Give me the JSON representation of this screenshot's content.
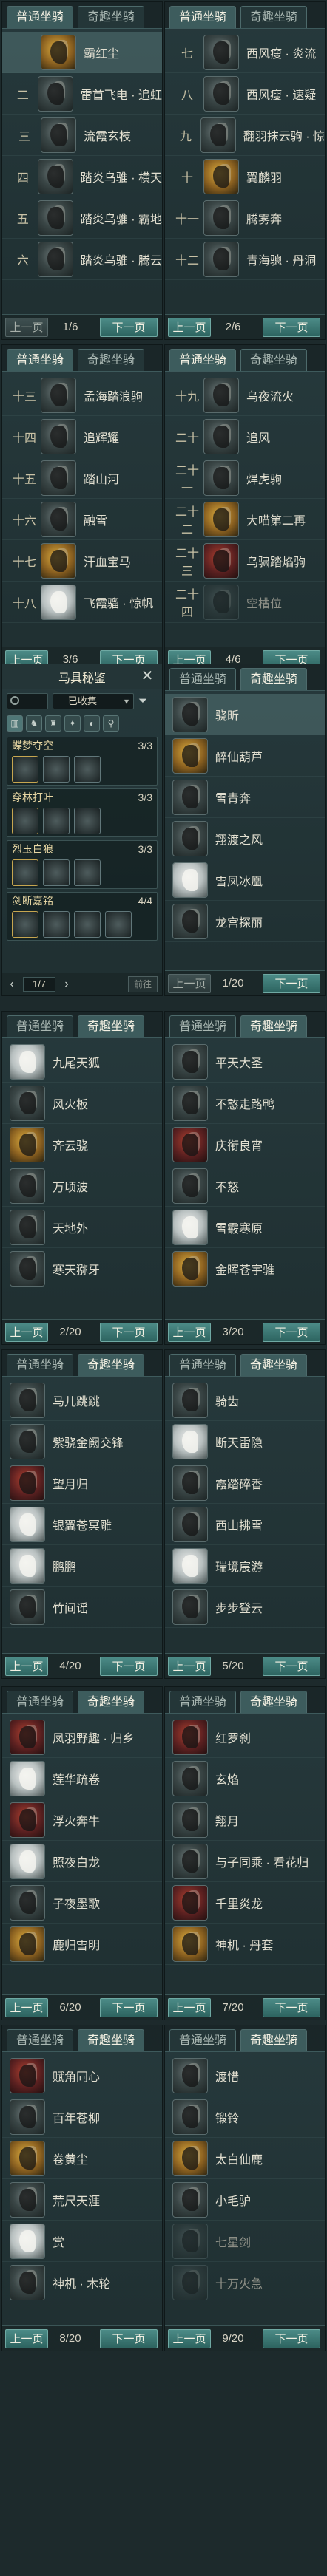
{
  "tabs": {
    "common": "普通坐骑",
    "special": "奇趣坐骑"
  },
  "buttons": {
    "prev": "上一页",
    "next": "下一页"
  },
  "panels": [
    {
      "page": "1/6",
      "prev_enabled": false,
      "rows": [
        {
          "idx": "",
          "name": "霸红尘",
          "icon": "horse-head-icon",
          "tone": "gold",
          "selected": true
        },
        {
          "idx": "二",
          "name": "雷首飞电 · 追虹",
          "icon": "horse-head-icon",
          "tone": ""
        },
        {
          "idx": "三",
          "name": "流霞玄枝",
          "icon": "horse-head-icon",
          "tone": ""
        },
        {
          "idx": "四",
          "name": "踏炎乌骓 · 横天",
          "icon": "horse-head-icon",
          "tone": ""
        },
        {
          "idx": "五",
          "name": "踏炎乌骓 · 霸地",
          "icon": "horse-head-icon",
          "tone": ""
        },
        {
          "idx": "六",
          "name": "踏炎乌骓 · 腾云",
          "icon": "horse-head-icon",
          "tone": ""
        }
      ]
    },
    {
      "page": "2/6",
      "prev_enabled": true,
      "rows": [
        {
          "idx": "七",
          "name": "西风瘦 · 炎流",
          "icon": "horse-head-icon",
          "tone": ""
        },
        {
          "idx": "八",
          "name": "西风瘦 · 速疑",
          "icon": "horse-head-icon",
          "tone": ""
        },
        {
          "idx": "九",
          "name": "翻羽抹云驹 · 惊",
          "icon": "horse-head-icon",
          "tone": ""
        },
        {
          "idx": "十",
          "name": "翼麟羽",
          "icon": "horse-head-icon",
          "tone": "gold"
        },
        {
          "idx": "十一",
          "name": "腾雾奔",
          "icon": "horse-head-icon",
          "tone": ""
        },
        {
          "idx": "十二",
          "name": "青海骢 · 丹洞",
          "icon": "horse-head-icon",
          "tone": ""
        }
      ]
    },
    {
      "page": "3/6",
      "prev_enabled": true,
      "rows": [
        {
          "idx": "十三",
          "name": "孟海踏浪驹",
          "icon": "horse-head-icon",
          "tone": ""
        },
        {
          "idx": "十四",
          "name": "追辉耀",
          "icon": "horse-head-icon",
          "tone": ""
        },
        {
          "idx": "十五",
          "name": "踏山河",
          "icon": "horse-head-icon",
          "tone": ""
        },
        {
          "idx": "十六",
          "name": "融雪",
          "icon": "horse-head-icon",
          "tone": ""
        },
        {
          "idx": "十七",
          "name": "汗血宝马",
          "icon": "horse-head-icon",
          "tone": "gold"
        },
        {
          "idx": "十八",
          "name": "飞霞骝 · 惊帆",
          "icon": "horse-head-icon",
          "tone": "light"
        }
      ]
    },
    {
      "page": "4/6",
      "prev_enabled": true,
      "rows": [
        {
          "idx": "十九",
          "name": "乌夜流火",
          "icon": "horse-head-icon",
          "tone": ""
        },
        {
          "idx": "二十",
          "name": "追风",
          "icon": "horse-head-icon",
          "tone": ""
        },
        {
          "idx": "二十一",
          "name": "焊虎驹",
          "icon": "horse-head-icon",
          "tone": ""
        },
        {
          "idx": "二十二",
          "name": "大喵第二再",
          "icon": "cat-face-icon",
          "tone": "gold"
        },
        {
          "idx": "二十三",
          "name": "乌骕踏焰驹",
          "icon": "horse-head-icon",
          "tone": "red"
        },
        {
          "idx": "二十四",
          "name": "空槽位",
          "icon": "empty-slot-icon",
          "tone": "dim",
          "dim": true
        }
      ]
    },
    {
      "page": "1/20",
      "prev_enabled": false,
      "special": true,
      "rows": [
        {
          "idx": "",
          "name": "骁昕",
          "icon": "mount-icon",
          "tone": "",
          "selected": true
        },
        {
          "idx": "",
          "name": "醉仙葫芦",
          "icon": "gourd-icon",
          "tone": "gold"
        },
        {
          "idx": "",
          "name": "雪青奔",
          "icon": "mount-icon",
          "tone": ""
        },
        {
          "idx": "",
          "name": "翔渡之风",
          "icon": "mount-icon",
          "tone": ""
        },
        {
          "idx": "",
          "name": "雪凤冰凰",
          "icon": "phoenix-icon",
          "tone": "light"
        },
        {
          "idx": "",
          "name": "龙宫探丽",
          "icon": "mount-icon",
          "tone": ""
        }
      ]
    },
    {
      "page": "2/20",
      "prev_enabled": true,
      "special": true,
      "rows": [
        {
          "idx": "",
          "name": "九尾天狐",
          "icon": "fox-icon",
          "tone": "light"
        },
        {
          "idx": "",
          "name": "风火板",
          "icon": "board-icon",
          "tone": ""
        },
        {
          "idx": "",
          "name": "齐云骁",
          "icon": "mount-icon",
          "tone": "gold"
        },
        {
          "idx": "",
          "name": "万顷波",
          "icon": "mount-icon",
          "tone": ""
        },
        {
          "idx": "",
          "name": "天地外",
          "icon": "mount-icon",
          "tone": ""
        },
        {
          "idx": "",
          "name": "寒天猕牙",
          "icon": "mount-icon",
          "tone": ""
        }
      ]
    },
    {
      "page": "3/20",
      "prev_enabled": true,
      "special": true,
      "rows": [
        {
          "idx": "",
          "name": "平天大圣",
          "icon": "mount-icon",
          "tone": ""
        },
        {
          "idx": "",
          "name": "不憨走路鸭",
          "icon": "duck-icon",
          "tone": ""
        },
        {
          "idx": "",
          "name": "庆衔良宵",
          "icon": "mount-icon",
          "tone": "red"
        },
        {
          "idx": "",
          "name": "不怒",
          "icon": "mount-icon",
          "tone": ""
        },
        {
          "idx": "",
          "name": "雪霰寒原",
          "icon": "mount-icon",
          "tone": "light"
        },
        {
          "idx": "",
          "name": "金晖苍宇骓",
          "icon": "mount-icon",
          "tone": "gold"
        }
      ]
    },
    {
      "page": "4/20",
      "prev_enabled": true,
      "special": true,
      "rows": [
        {
          "idx": "",
          "name": "马儿跳跳",
          "icon": "mount-icon",
          "tone": ""
        },
        {
          "idx": "",
          "name": "紫骁金阙交锋",
          "icon": "mount-icon",
          "tone": ""
        },
        {
          "idx": "",
          "name": "望月归",
          "icon": "mount-icon",
          "tone": "red"
        },
        {
          "idx": "",
          "name": "银翼苍冥雕",
          "icon": "eagle-icon",
          "tone": "light"
        },
        {
          "idx": "",
          "name": "鹏鹏",
          "icon": "mount-icon",
          "tone": "light"
        },
        {
          "idx": "",
          "name": "竹间谣",
          "icon": "mount-icon",
          "tone": ""
        }
      ]
    },
    {
      "page": "5/20",
      "prev_enabled": true,
      "special": true,
      "rows": [
        {
          "idx": "",
          "name": "骑齿",
          "icon": "mount-icon",
          "tone": ""
        },
        {
          "idx": "",
          "name": "断天雷隐",
          "icon": "mount-icon",
          "tone": "light"
        },
        {
          "idx": "",
          "name": "霞踏碎香",
          "icon": "mount-icon",
          "tone": ""
        },
        {
          "idx": "",
          "name": "西山拂雪",
          "icon": "mount-icon",
          "tone": ""
        },
        {
          "idx": "",
          "name": "瑞境宸游",
          "icon": "mount-icon",
          "tone": "light"
        },
        {
          "idx": "",
          "name": "步步登云",
          "icon": "mount-icon",
          "tone": ""
        }
      ]
    },
    {
      "page": "6/20",
      "prev_enabled": true,
      "special": true,
      "rows": [
        {
          "idx": "",
          "name": "凤羽野趣 · 归乡",
          "icon": "mount-icon",
          "tone": "red"
        },
        {
          "idx": "",
          "name": "莲华疏卷",
          "icon": "mount-icon",
          "tone": "light"
        },
        {
          "idx": "",
          "name": "浮火奔牛",
          "icon": "bull-icon",
          "tone": "red"
        },
        {
          "idx": "",
          "name": "照夜白龙",
          "icon": "dragon-icon",
          "tone": "light"
        },
        {
          "idx": "",
          "name": "子夜墨歌",
          "icon": "mount-icon",
          "tone": ""
        },
        {
          "idx": "",
          "name": "鹿归雪明",
          "icon": "deer-icon",
          "tone": "gold"
        }
      ]
    },
    {
      "page": "7/20",
      "prev_enabled": true,
      "special": true,
      "rows": [
        {
          "idx": "",
          "name": "红罗刹",
          "icon": "mount-icon",
          "tone": "red"
        },
        {
          "idx": "",
          "name": "玄焰",
          "icon": "mount-icon",
          "tone": ""
        },
        {
          "idx": "",
          "name": "翔月",
          "icon": "mount-icon",
          "tone": ""
        },
        {
          "idx": "",
          "name": "与子同乘 · 看花归",
          "icon": "mount-icon",
          "tone": ""
        },
        {
          "idx": "",
          "name": "千里炎龙",
          "icon": "mount-icon",
          "tone": "red"
        },
        {
          "idx": "",
          "name": "神机 · 丹套",
          "icon": "mount-icon",
          "tone": "gold"
        }
      ]
    },
    {
      "page": "8/20",
      "prev_enabled": true,
      "special": true,
      "rows": [
        {
          "idx": "",
          "name": "赋角同心",
          "icon": "mount-icon",
          "tone": "red"
        },
        {
          "idx": "",
          "name": "百年苍柳",
          "icon": "mount-icon",
          "tone": ""
        },
        {
          "idx": "",
          "name": "卷黄尘",
          "icon": "mount-icon",
          "tone": "gold"
        },
        {
          "idx": "",
          "name": "荒尺天涯",
          "icon": "mount-icon",
          "tone": ""
        },
        {
          "idx": "",
          "name": "赏",
          "icon": "mount-icon",
          "tone": "light"
        },
        {
          "idx": "",
          "name": "神机 · 木轮",
          "icon": "mount-icon",
          "tone": ""
        }
      ]
    },
    {
      "page": "9/20",
      "prev_enabled": true,
      "special": true,
      "rows": [
        {
          "idx": "",
          "name": "渡惜",
          "icon": "mount-icon",
          "tone": ""
        },
        {
          "idx": "",
          "name": "锻铃",
          "icon": "mount-icon",
          "tone": ""
        },
        {
          "idx": "",
          "name": "太白仙鹿",
          "icon": "deer-icon",
          "tone": "gold"
        },
        {
          "idx": "",
          "name": "小毛驴",
          "icon": "donkey-icon",
          "tone": ""
        },
        {
          "idx": "",
          "name": "七星剑",
          "icon": "sword-icon",
          "tone": "dim",
          "dim": true
        },
        {
          "idx": "",
          "name": "十万火急",
          "icon": "mount-icon",
          "tone": "dim",
          "dim": true
        }
      ]
    }
  ],
  "bag": {
    "title": "马具秘鉴",
    "close": "✕",
    "filter_value": "已收集",
    "filter_icon": "funnel-icon",
    "categories": [
      "▥",
      "♞",
      "♜",
      "✦",
      "◐",
      "⚲"
    ],
    "sets": [
      {
        "name": "蝶梦夺空",
        "count": "3/3",
        "slots": 3
      },
      {
        "name": "穿林打叶",
        "count": "3/3",
        "slots": 3
      },
      {
        "name": "烈玉白狼",
        "count": "3/3",
        "slots": 3
      },
      {
        "name": "剑断嘉铭",
        "count": "4/4",
        "slots": 4
      }
    ],
    "page_value": "1",
    "page_total": "/7",
    "jump": "前往"
  },
  "colors": {
    "accent": "#3f7f7a",
    "panel": "#26393c",
    "gold": "#e7d6a3"
  }
}
